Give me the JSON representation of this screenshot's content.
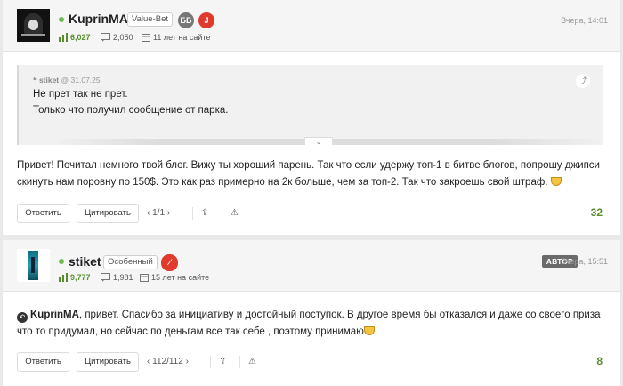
{
  "post1": {
    "username": "KuprinMA",
    "badge": "Value-Bet",
    "round_badges": [
      "ББ",
      "J"
    ],
    "rating": "6,027",
    "posts": "2,050",
    "tenure": "11 лет на сайте",
    "time": "Вчера, 14:01",
    "quote": {
      "author": "stiket",
      "date": "@ 31.07.25",
      "line1": "Не прет так не прет.",
      "line2": "Только что получил сообщение от парка.",
      "expand_icon": "chevron-down-icon",
      "corner_icon": "jump-to-source-icon"
    },
    "text_line1": "Привет! Почитал немного твой блог. Вижу ты хороший парень. Так что если удержу топ-1 в битве блогов, попрошу джипси",
    "text_line2": "скинуть нам поровну по 150$. Это как раз примерно на 2к больше, чем за топ-2. Так что закроешь свой штраф.",
    "reply_label": "Ответить",
    "cite_label": "Цитировать",
    "pager": "1/1",
    "score": "32"
  },
  "post2": {
    "username": "stiket",
    "badge": "Особенный",
    "rating": "9,777",
    "posts": "1,981",
    "tenure": "15 лет на сайте",
    "author_label": "АВТОР",
    "time": "Вчера, 15:51",
    "mention": "KuprinMA",
    "text_line1_rest": ", привет. Спасибо за инициативу и достойный поступок. В другое время бы отказался и даже со своего приза",
    "text_line2": "что то придумал, но сейчас по деньгам все так себе , поэтому принимаю",
    "reply_label": "Ответить",
    "cite_label": "Цитировать",
    "pager": "112/112",
    "score": "8"
  },
  "colors": {
    "accent_green": "#5a8d2d",
    "online_dot": "#6abf4b",
    "badge_red": "#e03a2c",
    "badge_gray": "#777777"
  }
}
